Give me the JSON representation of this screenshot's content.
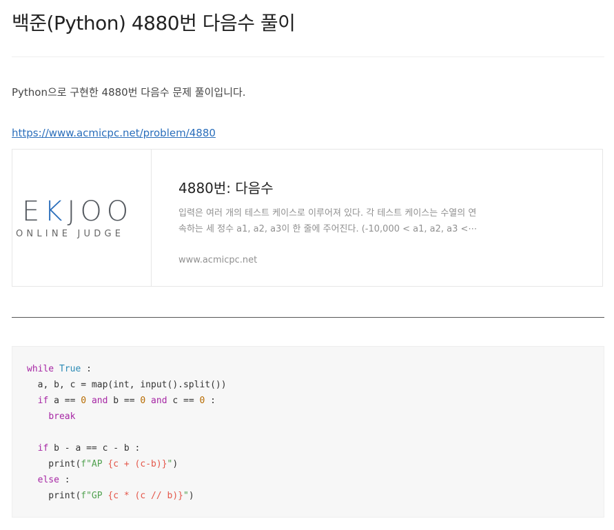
{
  "post": {
    "title": "백준(Python) 4880번 다음수 풀이",
    "intro": "Python으로 구현한 4880번 다음수 문제 풀이입니다.",
    "link": "https://www.acmicpc.net/problem/4880"
  },
  "card": {
    "logo_main": "EKJOO",
    "logo_sub": "ONLINE JUDGE",
    "title": "4880번: 다음수",
    "desc_lines": [
      "입력은 여러 개의 테스트 케이스로 이루어져 있다. 각 테스트 케이스는 수열의 연",
      "속하는 세 정수 a1, a2, a3이 한 줄에 주어진다. (-10,000 < a1, a2, a3 <⋯"
    ],
    "url": "www.acmicpc.net"
  },
  "code": {
    "lines": [
      [
        {
          "t": "while ",
          "c": "kw"
        },
        {
          "t": "True",
          "c": "bi"
        },
        {
          "t": " :",
          "c": ""
        }
      ],
      [
        {
          "t": "  a, b, c = map(int, input().split())",
          "c": ""
        }
      ],
      [
        {
          "t": "  ",
          "c": ""
        },
        {
          "t": "if",
          "c": "kw"
        },
        {
          "t": " a == ",
          "c": ""
        },
        {
          "t": "0",
          "c": "num"
        },
        {
          "t": " ",
          "c": ""
        },
        {
          "t": "and",
          "c": "kw"
        },
        {
          "t": " b == ",
          "c": ""
        },
        {
          "t": "0",
          "c": "num"
        },
        {
          "t": " ",
          "c": ""
        },
        {
          "t": "and",
          "c": "kw"
        },
        {
          "t": " c == ",
          "c": ""
        },
        {
          "t": "0",
          "c": "num"
        },
        {
          "t": " :",
          "c": ""
        }
      ],
      [
        {
          "t": "    ",
          "c": ""
        },
        {
          "t": "break",
          "c": "kw"
        }
      ],
      [
        {
          "t": "",
          "c": ""
        }
      ],
      [
        {
          "t": "  ",
          "c": ""
        },
        {
          "t": "if",
          "c": "kw"
        },
        {
          "t": " b - a == c - b :",
          "c": ""
        }
      ],
      [
        {
          "t": "    print(",
          "c": ""
        },
        {
          "t": "f\"AP ",
          "c": "str"
        },
        {
          "t": "{c + (c-b)}",
          "c": "sub"
        },
        {
          "t": "\"",
          "c": "str"
        },
        {
          "t": ")",
          "c": ""
        }
      ],
      [
        {
          "t": "  ",
          "c": ""
        },
        {
          "t": "else",
          "c": "kw"
        },
        {
          "t": " :",
          "c": ""
        }
      ],
      [
        {
          "t": "    print(",
          "c": ""
        },
        {
          "t": "f\"GP ",
          "c": "str"
        },
        {
          "t": "{c * (c // b)}",
          "c": "sub"
        },
        {
          "t": "\"",
          "c": "str"
        },
        {
          "t": ")",
          "c": ""
        }
      ]
    ]
  }
}
